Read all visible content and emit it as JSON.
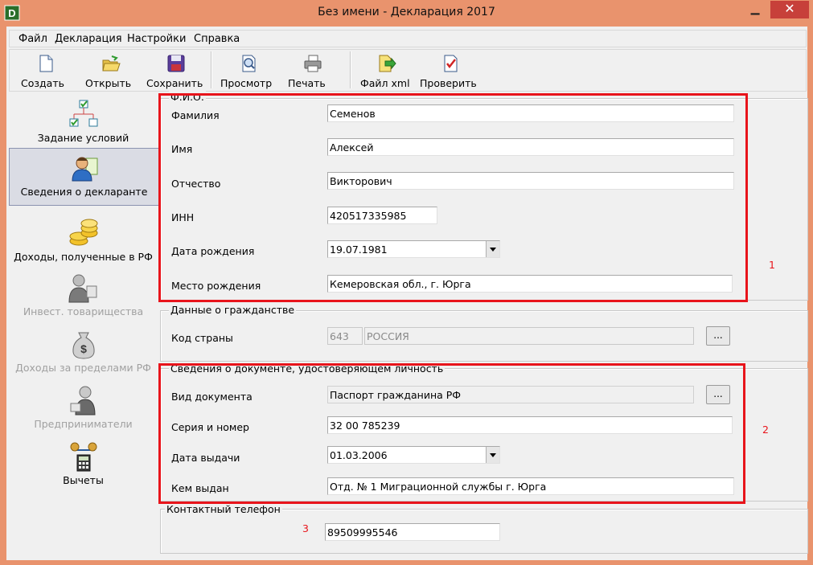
{
  "window": {
    "title": "Без имени - Декларация 2017",
    "app_icon": "D"
  },
  "menu": [
    "Файл",
    "Декларация",
    "Настройки",
    "Справка"
  ],
  "toolbar": {
    "create": "Создать",
    "open": "Открыть",
    "save": "Сохранить",
    "preview": "Просмотр",
    "print": "Печать",
    "xml": "Файл xml",
    "check": "Проверить"
  },
  "nav": {
    "conditions": "Задание условий",
    "declarant": "Сведения о декларанте",
    "income_rf": "Доходы, полученные в РФ",
    "invest": "Инвест. товарищества",
    "income_abroad": "Доходы за пределами РФ",
    "entrepreneurs": "Предприниматели",
    "deductions": "Вычеты"
  },
  "fio": {
    "group_title": "Ф.И.О.",
    "surname_label": "Фамилия",
    "surname": "Семенов",
    "name_label": "Имя",
    "name": "Алексей",
    "patronymic_label": "Отчество",
    "patronymic": "Викторович",
    "inn_label": "ИНН",
    "inn": "420517335985",
    "birthdate_label": "Дата рождения",
    "birthdate": "19.07.1981",
    "birthplace_label": "Место рождения",
    "birthplace": "Кемеровская обл., г. Юрга"
  },
  "citizenship": {
    "group_title": "Данные о гражданстве",
    "country_label": "Код страны",
    "country_code": "643",
    "country_name": "РОССИЯ",
    "browse": "..."
  },
  "document": {
    "group_title": "Сведения о документе, удостоверяющем личность",
    "type_label": "Вид документа",
    "type": "Паспорт гражданина РФ",
    "browse": "...",
    "series_label": "Серия и номер",
    "series": "32 00 785239",
    "issue_date_label": "Дата выдачи",
    "issue_date": "01.03.2006",
    "issued_by_label": "Кем выдан",
    "issued_by": "Отд. № 1 Миграционной службы г. Юрга"
  },
  "contact": {
    "group_title": "Контактный телефон",
    "phone": "89509995546"
  },
  "annotations": [
    "1",
    "2",
    "3"
  ],
  "colors": {
    "highlight": "#e8141b",
    "frame": "#e9936d",
    "close": "#c7403a"
  }
}
